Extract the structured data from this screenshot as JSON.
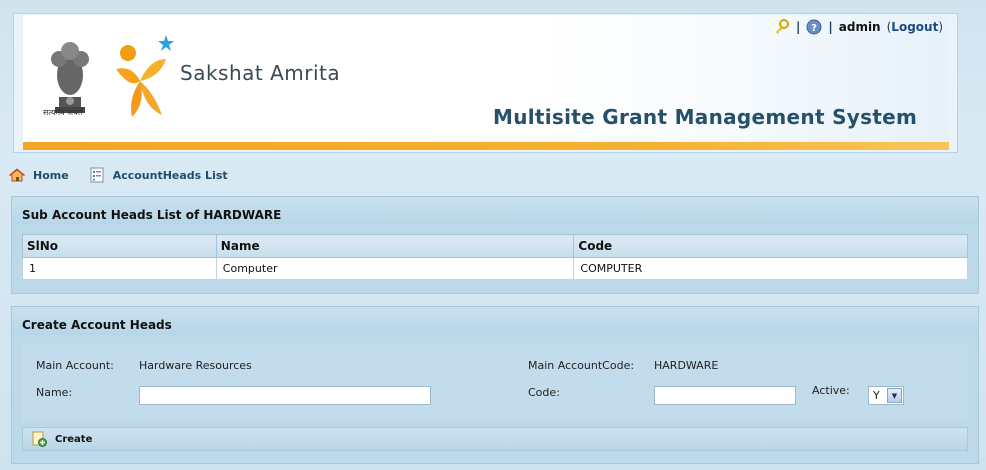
{
  "header": {
    "emblem_caption": "सत्यमेव जयते",
    "brand_name": "Sakshat Amrita",
    "system_title": "Multisite Grant Management System",
    "username": "admin",
    "logout_label": "Logout",
    "separator": "|",
    "icons": [
      "key-icon",
      "help-icon"
    ]
  },
  "nav": {
    "home_label": "Home",
    "accountheads_label": "AccountHeads List"
  },
  "sub_list": {
    "title": "Sub Account Heads List of HARDWARE",
    "columns": [
      "SlNo",
      "Name",
      "Code"
    ],
    "rows": [
      {
        "slno": "1",
        "name": "Computer",
        "code": "COMPUTER"
      }
    ]
  },
  "create_form": {
    "title": "Create Account Heads",
    "main_account_label": "Main Account:",
    "main_account_value": "Hardware Resources",
    "main_account_code_label": "Main AccountCode:",
    "main_account_code_value": "HARDWARE",
    "name_label": "Name:",
    "name_value": "",
    "code_label": "Code:",
    "code_value": "",
    "active_label": "Active:",
    "active_value": "Y",
    "create_label": "Create"
  },
  "colors": {
    "brand_orange": "#f5a623",
    "title_blue": "#27506b",
    "panel_blue": "#bcd9ea"
  }
}
